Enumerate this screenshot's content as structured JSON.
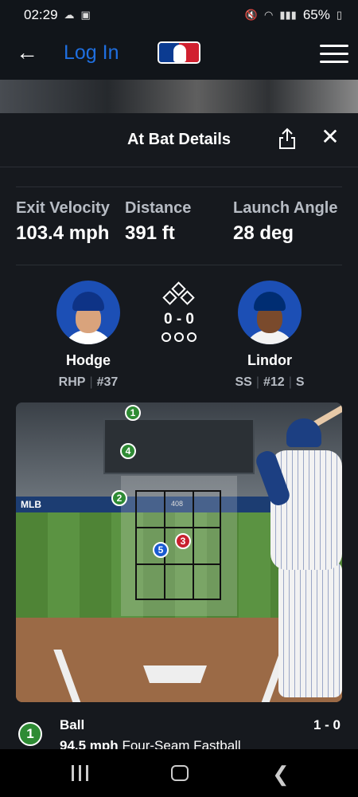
{
  "status_bar": {
    "time": "02:29",
    "battery": "65%"
  },
  "header": {
    "login_label": "Log In"
  },
  "sheet": {
    "title": "At Bat Details",
    "stats": [
      {
        "label": "Exit Velocity",
        "value": "103.4 mph"
      },
      {
        "label": "Distance",
        "value": "391 ft"
      },
      {
        "label": "Launch Angle",
        "value": "28 deg"
      }
    ]
  },
  "matchup": {
    "pitcher": {
      "name": "Hodge",
      "position": "RHP",
      "number": "#37"
    },
    "batter": {
      "name": "Lindor",
      "position": "SS",
      "number": "#12",
      "bats": "S"
    },
    "count": "0 - 0"
  },
  "scene": {
    "wall_text": "MLB",
    "zone_label": "408",
    "pitches": [
      {
        "label": "1",
        "type": "ball"
      },
      {
        "label": "4",
        "type": "ball"
      },
      {
        "label": "2",
        "type": "ball"
      },
      {
        "label": "3",
        "type": "strike"
      },
      {
        "label": "5",
        "type": "contact"
      }
    ]
  },
  "pitch_list": [
    {
      "number": "1",
      "result": "Ball",
      "speed": "94.5 mph",
      "pitch_type": "Four-Seam Fastball",
      "count": "1 - 0"
    }
  ],
  "colors": {
    "link": "#1f6fe0",
    "ball": "#2e8b34",
    "strike": "#c8202e",
    "contact": "#1a5bd1"
  },
  "icons": [
    "cloud-icon",
    "image-icon",
    "mute-icon",
    "wifi-icon",
    "signal-icon",
    "battery-icon",
    "back-arrow-icon",
    "mlb-logo-icon",
    "menu-icon",
    "share-icon",
    "close-icon",
    "recent-apps-icon",
    "home-icon",
    "nav-back-icon"
  ]
}
